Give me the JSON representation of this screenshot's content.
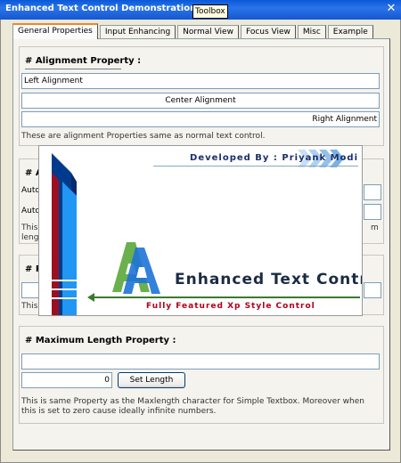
{
  "window": {
    "title": "Enhanced Text Control Demonstrations ::.",
    "tooltip": "Toolbox"
  },
  "tabs": [
    {
      "label": "General Properties",
      "active": true
    },
    {
      "label": "Input Enhancing"
    },
    {
      "label": "Normal View"
    },
    {
      "label": "Focus View"
    },
    {
      "label": "Misc"
    },
    {
      "label": "Example"
    }
  ],
  "alignment": {
    "title": "# Alignment Property :",
    "left": "Left Alignment",
    "center": "Center Alignment",
    "right": "Right Alignment",
    "note": "These are alignment Properties same as normal text control."
  },
  "group2": {
    "title_partial": "# Au",
    "row1_label": "Auto",
    "row2_label": "Auto",
    "note_line1": "This",
    "note_line2": "lengt",
    "note_right": "m"
  },
  "group3": {
    "title_partial": "# Pa",
    "note": "This"
  },
  "maxlength": {
    "title": "# Maximum Length Property :",
    "input_value": "",
    "length_value": "0",
    "set_button": "Set Length",
    "note": "This is same Property as the Maxlength character for Simple Textbox. Moreover when this is set to zero cause ideally infinite numbers."
  },
  "splash": {
    "developer": "Developed By : Priyank Modi",
    "brand": "Enhanced Text Control",
    "tagline": "Fully Featured Xp Style Control",
    "logo_text": "AA"
  },
  "colors": {
    "titlebar": "#0a58d8",
    "tab_highlight": "#e68b2c",
    "tagline": "#b0001a",
    "accent_blue": "#1e90ff"
  }
}
